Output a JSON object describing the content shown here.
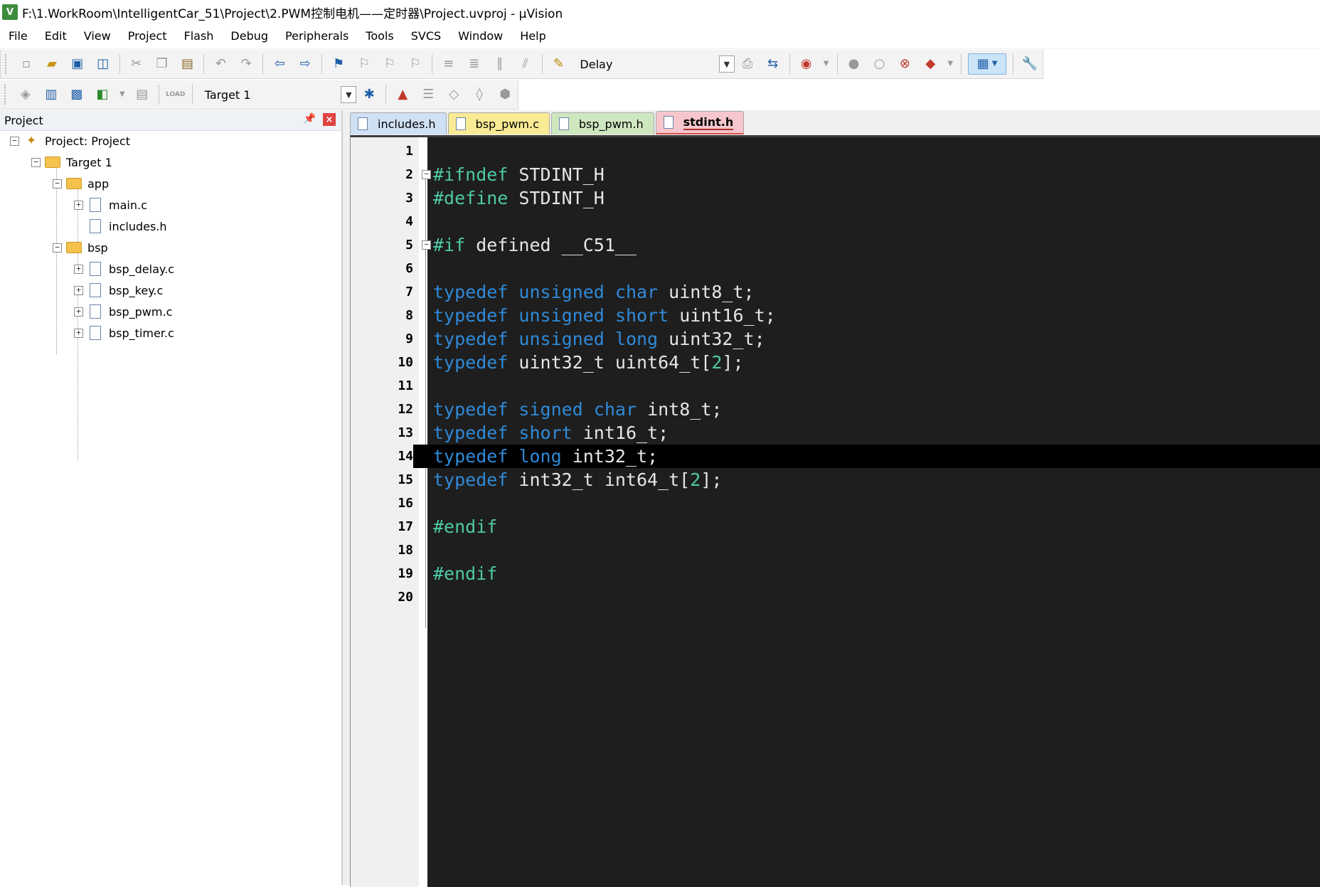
{
  "window": {
    "title": "F:\\1.WorkRoom\\IntelligentCar_51\\Project\\2.PWM控制电机——定时器\\Project.uvproj - µVision"
  },
  "menu": [
    "File",
    "Edit",
    "View",
    "Project",
    "Flash",
    "Debug",
    "Peripherals",
    "Tools",
    "SVCS",
    "Window",
    "Help"
  ],
  "toolbar": {
    "find_combo": "Delay",
    "target_combo": "Target 1",
    "load_label": "LOAD"
  },
  "project_panel": {
    "title": "Project",
    "tree": {
      "root": "Project: Project",
      "target": "Target 1",
      "groups": [
        {
          "name": "app",
          "files": [
            "main.c",
            "includes.h"
          ]
        },
        {
          "name": "bsp",
          "files": [
            "bsp_delay.c",
            "bsp_key.c",
            "bsp_pwm.c",
            "bsp_timer.c"
          ]
        }
      ]
    }
  },
  "tabs": [
    {
      "label": "includes.h",
      "active": false
    },
    {
      "label": "bsp_pwm.c",
      "active": false
    },
    {
      "label": "bsp_pwm.h",
      "active": false
    },
    {
      "label": "stdint.h",
      "active": true
    }
  ],
  "editor": {
    "current_line": 14,
    "lines": [
      {
        "n": "1",
        "code": []
      },
      {
        "n": "2",
        "code": [
          [
            "pp",
            "#ifndef"
          ],
          [
            "t",
            " STDINT_H"
          ]
        ]
      },
      {
        "n": "3",
        "code": [
          [
            "pp",
            "#define"
          ],
          [
            "t",
            " STDINT_H"
          ]
        ]
      },
      {
        "n": "4",
        "code": []
      },
      {
        "n": "5",
        "code": [
          [
            "pp",
            "#if"
          ],
          [
            "t",
            " defined __C51__"
          ]
        ]
      },
      {
        "n": "6",
        "code": []
      },
      {
        "n": "7",
        "code": [
          [
            "kw",
            "typedef"
          ],
          [
            "t",
            " "
          ],
          [
            "kw",
            "unsigned"
          ],
          [
            "t",
            " "
          ],
          [
            "kw",
            "char"
          ],
          [
            "t",
            " uint8_t;"
          ]
        ]
      },
      {
        "n": "8",
        "code": [
          [
            "kw",
            "typedef"
          ],
          [
            "t",
            " "
          ],
          [
            "kw",
            "unsigned"
          ],
          [
            "t",
            " "
          ],
          [
            "kw",
            "short"
          ],
          [
            "t",
            " uint16_t;"
          ]
        ]
      },
      {
        "n": "9",
        "code": [
          [
            "kw",
            "typedef"
          ],
          [
            "t",
            " "
          ],
          [
            "kw",
            "unsigned"
          ],
          [
            "t",
            " "
          ],
          [
            "kw",
            "long"
          ],
          [
            "t",
            " uint32_t;"
          ]
        ]
      },
      {
        "n": "10",
        "code": [
          [
            "kw",
            "typedef"
          ],
          [
            "t",
            " uint32_t uint64_t["
          ],
          [
            "num",
            "2"
          ],
          [
            "t",
            "];"
          ]
        ]
      },
      {
        "n": "11",
        "code": []
      },
      {
        "n": "12",
        "code": [
          [
            "kw",
            "typedef"
          ],
          [
            "t",
            " "
          ],
          [
            "kw",
            "signed"
          ],
          [
            "t",
            " "
          ],
          [
            "kw",
            "char"
          ],
          [
            "t",
            " int8_t;"
          ]
        ]
      },
      {
        "n": "13",
        "code": [
          [
            "kw",
            "typedef"
          ],
          [
            "t",
            " "
          ],
          [
            "kw",
            "short"
          ],
          [
            "t",
            " int16_t;"
          ]
        ]
      },
      {
        "n": "14",
        "code": [
          [
            "kw",
            "typedef"
          ],
          [
            "t",
            " "
          ],
          [
            "kw",
            "long"
          ],
          [
            "t",
            " int32_t;"
          ]
        ]
      },
      {
        "n": "15",
        "code": [
          [
            "kw",
            "typedef"
          ],
          [
            "t",
            " int32_t int64_t["
          ],
          [
            "num",
            "2"
          ],
          [
            "t",
            "];"
          ]
        ]
      },
      {
        "n": "16",
        "code": []
      },
      {
        "n": "17",
        "code": [
          [
            "pp",
            "#endif"
          ]
        ]
      },
      {
        "n": "18",
        "code": []
      },
      {
        "n": "19",
        "code": [
          [
            "pp",
            "#endif"
          ]
        ]
      },
      {
        "n": "20",
        "code": []
      }
    ]
  },
  "colors": {
    "keyword": "#2f8ad8",
    "preprocessor": "#4ec9a5",
    "editor_bg": "#1e1e1e",
    "current_line_bg": "#000000"
  }
}
